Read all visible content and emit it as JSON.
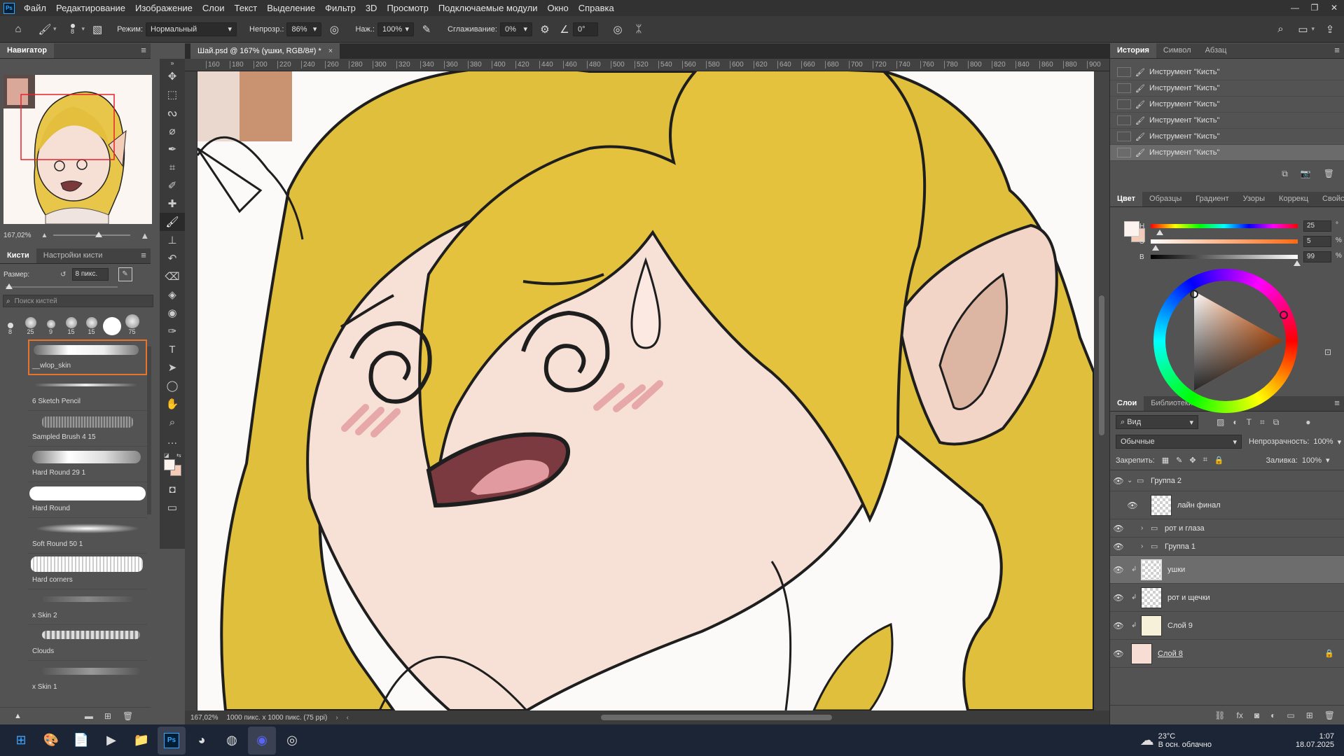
{
  "menu": [
    "Файл",
    "Редактирование",
    "Изображение",
    "Слои",
    "Текст",
    "Выделение",
    "Фильтр",
    "3D",
    "Просмотр",
    "Подключаемые модули",
    "Окно",
    "Справка"
  ],
  "options": {
    "brush_size": "8",
    "mode_label": "Режим:",
    "mode_value": "Нормальный",
    "opacity_label": "Непрозр.:",
    "opacity_value": "86%",
    "pressure_label": "Наж.:",
    "pressure_value": "100%",
    "smoothing_label": "Сглаживание:",
    "smoothing_value": "0%",
    "angle_value": "0°"
  },
  "navigator": {
    "title": "Навигатор",
    "zoom": "167,02%"
  },
  "brushes": {
    "tab_brushes": "Кисти",
    "tab_settings": "Настройки кисти",
    "size_label": "Размер:",
    "size_value": "8 пикс.",
    "search_placeholder": "Поиск кистей",
    "presets": [
      "8",
      "25",
      "9",
      "15",
      "15",
      "",
      "75"
    ],
    "list": [
      "__wlop_skin",
      "6 Sketch Pencil",
      "Sampled Brush 4 15",
      "Hard Round 29 1",
      "Hard Round",
      "Soft Round 50 1",
      "Hard corners",
      "x Skin 2",
      "Clouds",
      "x Skin 1"
    ]
  },
  "document": {
    "tab_title": "Шай.psd @ 167% (ушки, RGB/8#) *",
    "status_zoom": "167,02%",
    "status_info": "1000 пикс. x 1000 пикс. (75 ppi)",
    "ruler_ticks": [
      "160",
      "180",
      "200",
      "220",
      "240",
      "260",
      "280",
      "300",
      "320",
      "340",
      "360",
      "380",
      "400",
      "420",
      "440",
      "460",
      "480",
      "500",
      "520",
      "540",
      "560",
      "580",
      "600",
      "620",
      "640",
      "660",
      "680",
      "700",
      "720",
      "740",
      "760",
      "780",
      "800",
      "820",
      "840",
      "860",
      "880",
      "900"
    ]
  },
  "history": {
    "tabs": [
      "История",
      "Символ",
      "Абзац"
    ],
    "items": [
      "Инструмент \"Кисть\"",
      "Инструмент \"Кисть\"",
      "Инструмент \"Кисть\"",
      "Инструмент \"Кисть\"",
      "Инструмент \"Кисть\"",
      "Инструмент \"Кисть\""
    ]
  },
  "color": {
    "tabs": [
      "Цвет",
      "Образцы",
      "Градиент",
      "Узоры",
      "Коррекц",
      "Свойства"
    ],
    "h_label": "H",
    "s_label": "S",
    "b_label": "B",
    "h": "25",
    "s": "5",
    "b": "99",
    "deg": "°",
    "pct": "%",
    "fg": "#fcf2ee",
    "bg": "#f4cbb6"
  },
  "layers": {
    "tabs": [
      "Слои",
      "Библиотеки"
    ],
    "filter": "Вид",
    "blend": "Обычные",
    "opacity_label": "Непрозрачность:",
    "opacity": "100%",
    "lock_label": "Закрепить:",
    "fill_label": "Заливка:",
    "fill": "100%",
    "rows": [
      {
        "name": "Группа 2"
      },
      {
        "name": "лайн финал"
      },
      {
        "name": "рот и глаза"
      },
      {
        "name": "Группа 1"
      },
      {
        "name": "ушки"
      },
      {
        "name": "рот и щечки"
      },
      {
        "name": "Слой 9"
      },
      {
        "name": "Слой 8"
      }
    ]
  },
  "taskbar": {
    "temp": "23°C",
    "weather": "В осн. облачно",
    "time": "1:07",
    "date": "18.07.2025"
  }
}
